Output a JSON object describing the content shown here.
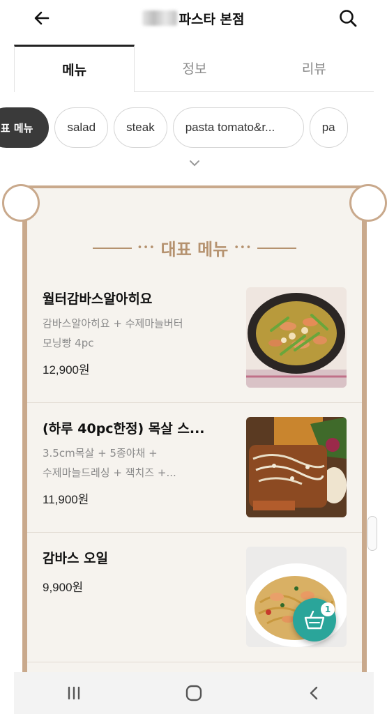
{
  "header": {
    "title": "파스타 본점"
  },
  "tabs": [
    {
      "label": "메뉴",
      "active": true
    },
    {
      "label": "정보",
      "active": false
    },
    {
      "label": "리뷰",
      "active": false
    }
  ],
  "chips": [
    {
      "label": "대표 메뉴",
      "active": true
    },
    {
      "label": "salad",
      "active": false
    },
    {
      "label": "steak",
      "active": false
    },
    {
      "label": "pasta tomato&r...",
      "active": false
    },
    {
      "label": "pa",
      "active": false
    }
  ],
  "section": {
    "title": "대표 메뉴",
    "ornament": "•••"
  },
  "menu_items": [
    {
      "name": "월터감바스알아히요",
      "desc_line1": "감바스알아히요 + 수제마늘버터",
      "desc_line2": "모닝빵 4pc",
      "price": "12,900원"
    },
    {
      "name": "(하루 40pc한정) 목살 스...",
      "desc_line1": "3.5cm목살 + 5종야채 +",
      "desc_line2": "수제마늘드레싱 + 잭치즈 +...",
      "price": "11,900원"
    },
    {
      "name": "감바스 오일",
      "desc_line1": "",
      "desc_line2": "",
      "price": "9,900원"
    }
  ],
  "cart": {
    "badge_count": "1"
  },
  "colors": {
    "accent_gold": "#b5926f",
    "panel_bg": "#f6f3ee",
    "cart_teal": "#2aa59a",
    "chip_active": "#3a3a3a"
  },
  "icons": {
    "back": "arrow-left",
    "search": "magnifier",
    "expand": "chevron-down",
    "cart": "basket",
    "nav_recent": "three-bars",
    "nav_home": "rounded-square",
    "nav_back": "chevron-left"
  }
}
